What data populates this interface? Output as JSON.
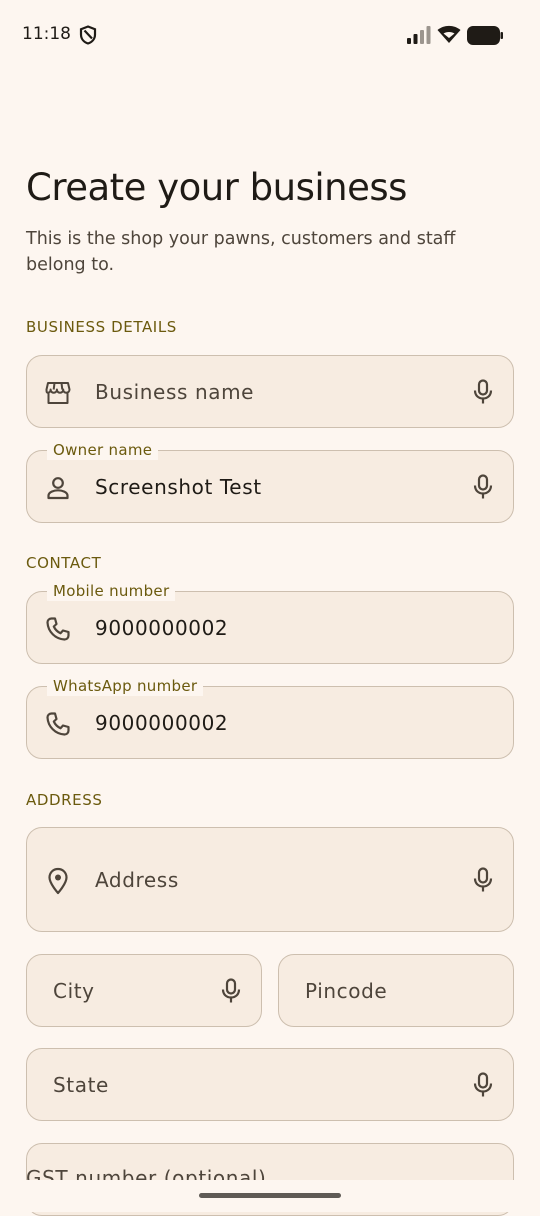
{
  "status_bar": {
    "time": "11:18"
  },
  "header": {
    "title": "Create your business",
    "subtitle": "This is the shop your pawns, customers and staff belong to."
  },
  "sections": {
    "business_details": "BUSINESS DETAILS",
    "contact": "CONTACT",
    "address": "ADDRESS"
  },
  "fields": {
    "business_name": {
      "placeholder": "Business name",
      "icon": "storefront-icon"
    },
    "owner_name": {
      "label": "Owner name",
      "value": "Screenshot Test",
      "icon": "person-icon"
    },
    "mobile_number": {
      "label": "Mobile number",
      "value": "9000000002",
      "icon": "phone-icon"
    },
    "whatsapp_number": {
      "label": "WhatsApp number",
      "value": "9000000002",
      "icon": "phone-icon"
    },
    "address": {
      "placeholder": "Address",
      "icon": "location-pin-icon"
    },
    "city": {
      "placeholder": "City"
    },
    "pincode": {
      "placeholder": "Pincode"
    },
    "state": {
      "placeholder": "State"
    },
    "gst_number": {
      "placeholder": "GST number (optional)"
    }
  },
  "colors": {
    "background": "#FDF6F0",
    "field_fill": "#F7ECE1",
    "field_border": "#CDBFAF",
    "section_accent": "#6B5A0E",
    "text_primary": "#1F1B16",
    "text_secondary": "#4E453B"
  }
}
